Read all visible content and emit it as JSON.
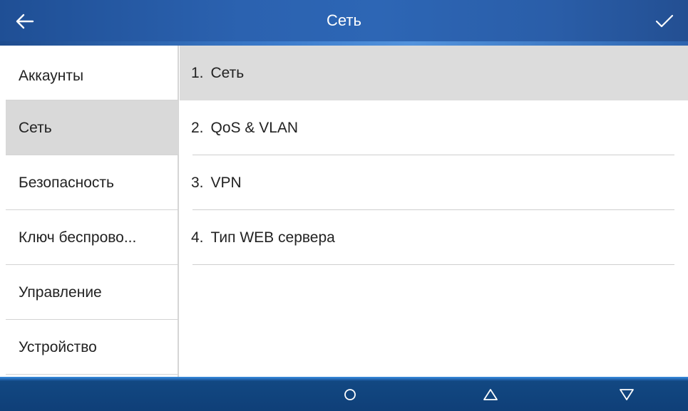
{
  "header": {
    "title": "Сеть",
    "back_icon": "arrow-left-icon",
    "confirm_icon": "check-icon"
  },
  "sidebar": {
    "items": [
      {
        "label": "Аккаунты"
      },
      {
        "label": "Сеть",
        "selected": true
      },
      {
        "label": "Безопасность"
      },
      {
        "label": "Ключ беспрово..."
      },
      {
        "label": "Управление"
      },
      {
        "label": "Устройство"
      }
    ]
  },
  "main": {
    "items": [
      {
        "number": "1.",
        "label": "Сеть",
        "highlighted": true
      },
      {
        "number": "2.",
        "label": "QoS & VLAN"
      },
      {
        "number": "3.",
        "label": "VPN"
      },
      {
        "number": "4.",
        "label": "Тип WEB сервера"
      }
    ]
  },
  "footer": {
    "buttons": [
      "circle-icon",
      "triangle-up-icon",
      "triangle-down-icon"
    ]
  },
  "colors": {
    "header_blue": "#2b62b0",
    "footer_blue": "#0f3f78",
    "selected_gray": "#d9d9d9",
    "text": "#222222"
  }
}
